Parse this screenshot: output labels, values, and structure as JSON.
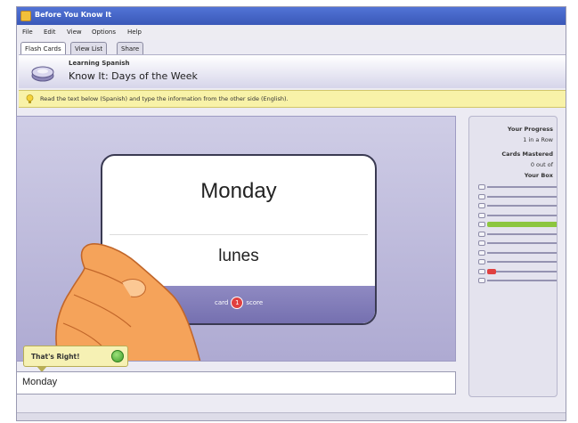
{
  "window": {
    "title": "Before You Know It"
  },
  "menu": [
    "File",
    "Edit",
    "View",
    "Options",
    "Help"
  ],
  "tabs": [
    {
      "label": "Flash Cards",
      "active": true
    },
    {
      "label": "View List",
      "active": false
    },
    {
      "label": "Share",
      "active": false
    }
  ],
  "deck": {
    "subtitle": "Learning Spanish",
    "title": "Know It: Days of the Week"
  },
  "hint": {
    "text": "Read the text below (Spanish) and type the information from the other side (English)."
  },
  "card": {
    "front": "Monday",
    "back": "lunes",
    "score_prefix": "card",
    "score_value": "1",
    "score_suffix": "score"
  },
  "feedback": {
    "text": "That's Right!",
    "status": "correct"
  },
  "answer_field": {
    "value": "Monday"
  },
  "progress_panel": {
    "heading": "Your Progress",
    "line1": "1 in a Row",
    "cards_heading": "Cards Mastered",
    "cards_value": "0 out of",
    "box_heading": "Your Box",
    "rows": [
      {
        "fill": 0.0,
        "color": "#9593b1"
      },
      {
        "fill": 0.0,
        "color": "#9593b1"
      },
      {
        "fill": 0.0,
        "color": "#9593b1"
      },
      {
        "fill": 0.0,
        "color": "#9593b1"
      },
      {
        "fill": 1.0,
        "color": "#8cc63f"
      },
      {
        "fill": 0.0,
        "color": "#9593b1"
      },
      {
        "fill": 0.0,
        "color": "#9593b1"
      },
      {
        "fill": 0.0,
        "color": "#9593b1"
      },
      {
        "fill": 0.0,
        "color": "#9593b1"
      },
      {
        "fill": 0.12,
        "color": "#e04040"
      },
      {
        "fill": 0.0,
        "color": "#9593b1"
      }
    ]
  },
  "colors": {
    "titlebar": "#3a58b8",
    "hint_bg": "#f8f2a8",
    "study_bg": "#c2bfe0",
    "footer": "#7570b0",
    "correct": "#3f9d2a"
  }
}
